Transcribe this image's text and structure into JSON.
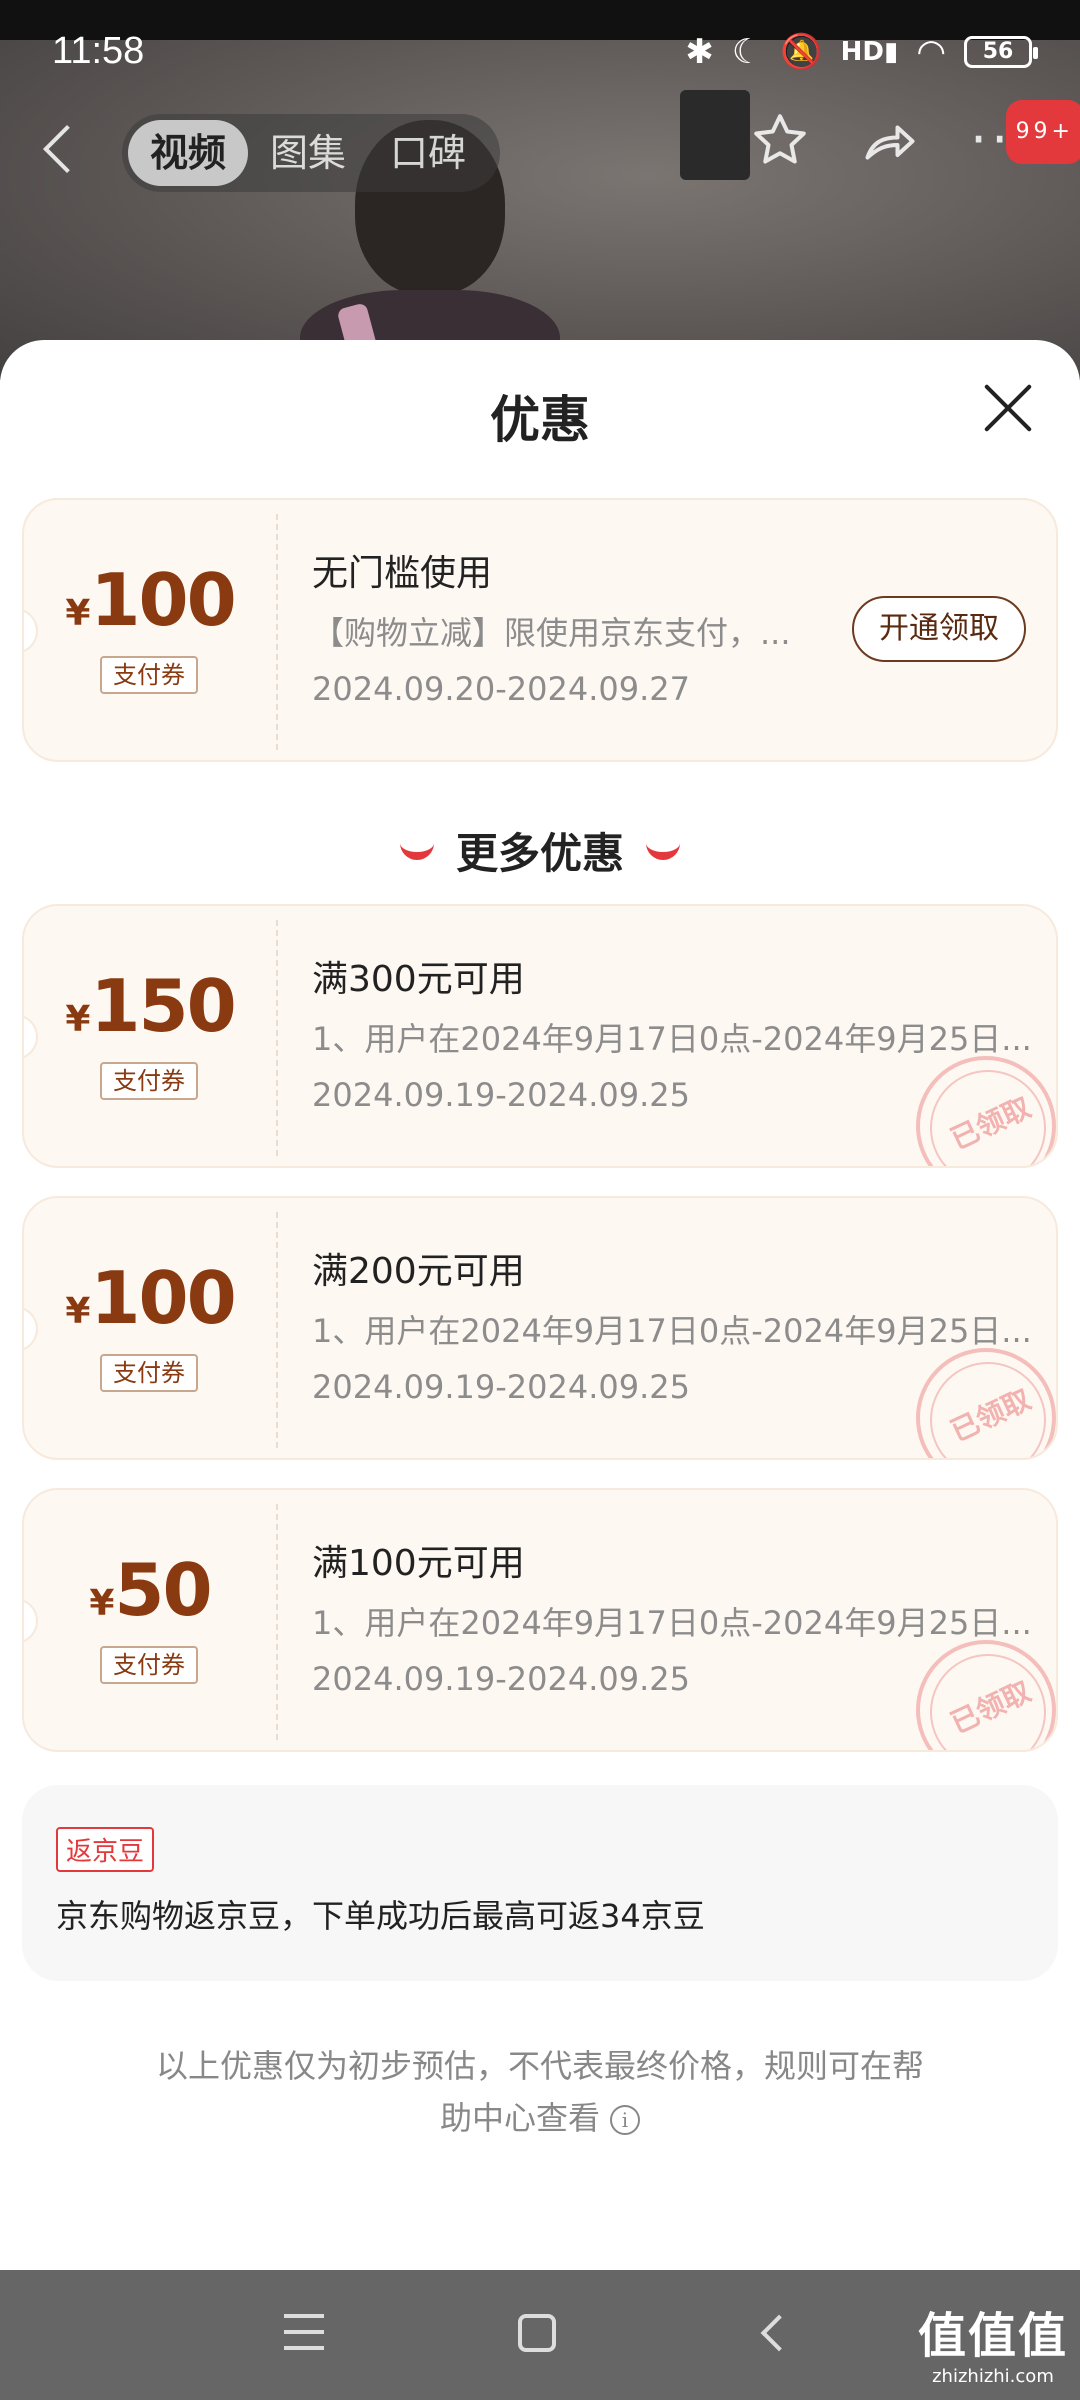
{
  "status_bar": {
    "time": "11:58",
    "battery": "56",
    "icons": [
      "bluetooth-icon",
      "moon-icon",
      "mute-icon",
      "signal-hd-icon",
      "wifi-icon",
      "battery-icon"
    ]
  },
  "top_nav": {
    "tabs": [
      {
        "label": "视频",
        "active": true
      },
      {
        "label": "图集",
        "active": false
      },
      {
        "label": "口碑",
        "active": false
      }
    ],
    "message_badge": "99+"
  },
  "sheet": {
    "title": "优惠",
    "first_coupon": {
      "currency": "¥",
      "amount": "100",
      "tag": "支付券",
      "title": "无门槛使用",
      "desc": "【购物立减】限使用京东支付，...",
      "date": "2024.09.20-2024.09.27",
      "button": "开通领取"
    },
    "more_heading": "更多优惠",
    "coupons": [
      {
        "currency": "¥",
        "amount": "150",
        "tag": "支付券",
        "title": "满300元可用",
        "desc": "1、用户在2024年9月17日0点-2024年9月25日...",
        "date": "2024.09.19-2024.09.25",
        "stamp": "已领取"
      },
      {
        "currency": "¥",
        "amount": "100",
        "tag": "支付券",
        "title": "满200元可用",
        "desc": "1、用户在2024年9月17日0点-2024年9月25日...",
        "date": "2024.09.19-2024.09.25",
        "stamp": "已领取"
      },
      {
        "currency": "¥",
        "amount": "50",
        "tag": "支付券",
        "title": "满100元可用",
        "desc": "1、用户在2024年9月17日0点-2024年9月25日...",
        "date": "2024.09.19-2024.09.25",
        "stamp": "已领取"
      }
    ],
    "jingdou": {
      "tag": "返京豆",
      "text": "京东购物返京豆，下单成功后最高可返34京豆"
    },
    "disclaimer_line1": "以上优惠仅为初步预估，不代表最终价格，规则可在帮",
    "disclaimer_line2": "助中心查看"
  },
  "watermark": {
    "main": "值值值",
    "sub": "zhizhizhi.com"
  },
  "colors": {
    "accent_red": "#e4393c",
    "coupon_brown": "#8a3a10",
    "coupon_bg": "#fef8f3"
  }
}
